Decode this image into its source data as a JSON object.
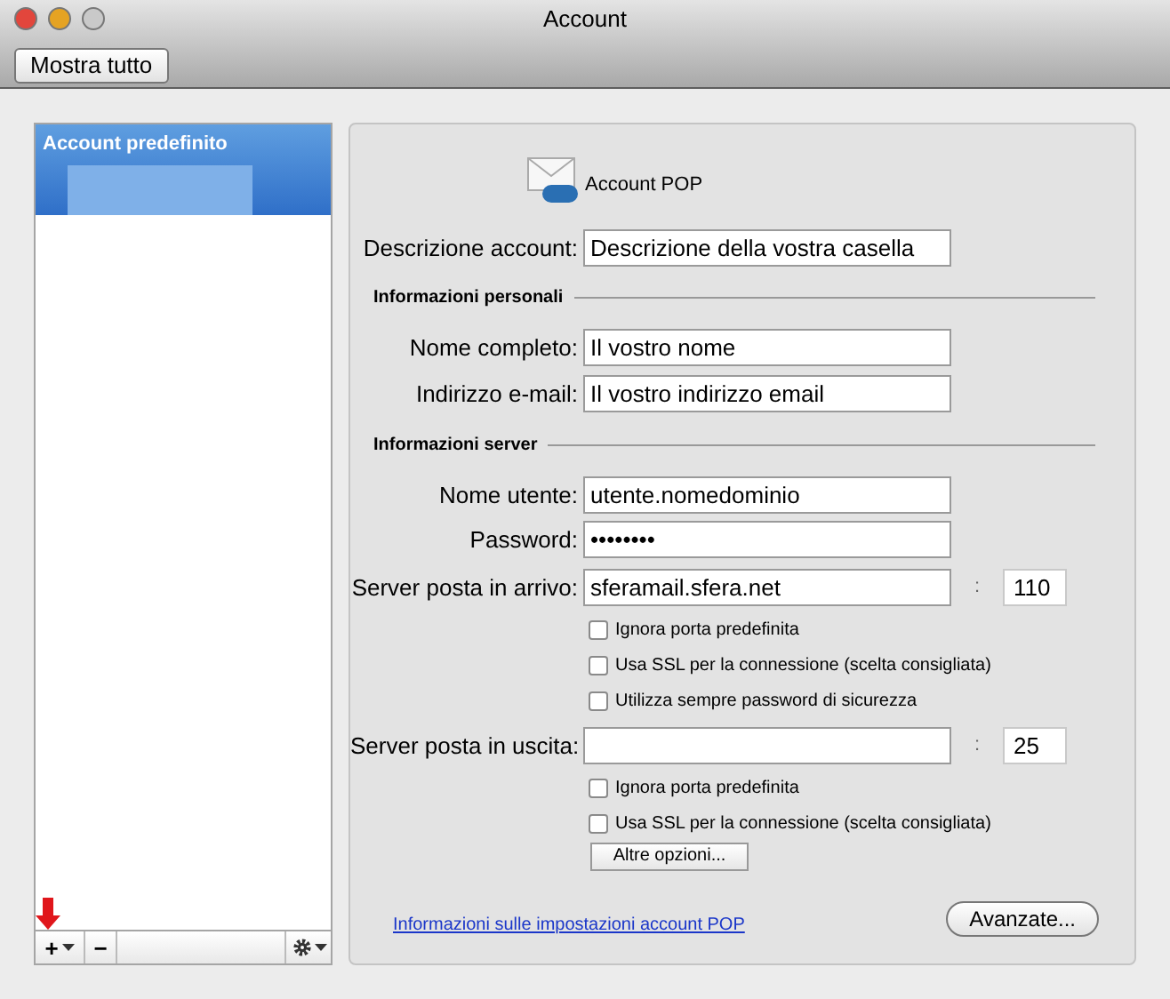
{
  "window": {
    "title": "Account"
  },
  "toolbar": {
    "show_all_button": "Mostra tutto"
  },
  "sidebar": {
    "items": [
      {
        "label": "Account predefinito",
        "selected": true,
        "redacted": true
      }
    ],
    "bottom_bar": {
      "add": "+",
      "remove": "−"
    }
  },
  "account": {
    "type_label": "Account POP",
    "description": {
      "label": "Descrizione account:",
      "value": "Descrizione della vostra casella"
    },
    "personal_heading": "Informazioni personali",
    "full_name": {
      "label": "Nome completo:",
      "value": "Il vostro nome"
    },
    "email": {
      "label": "Indirizzo e-mail:",
      "value": "Il vostro indirizzo email"
    },
    "server_heading": "Informazioni server",
    "username": {
      "label": "Nome utente:",
      "value": "utente.nomedominio"
    },
    "password": {
      "label": "Password:",
      "value": "••••••••"
    },
    "incoming": {
      "label": "Server posta in arrivo:",
      "value": "sferamail.sfera.net",
      "separator": ":",
      "port": "110",
      "options": [
        {
          "label": "Ignora porta predefinita",
          "checked": false
        },
        {
          "label": "Usa SSL per la connessione (scelta consigliata)",
          "checked": false
        },
        {
          "label": "Utilizza sempre password di sicurezza",
          "checked": false
        }
      ]
    },
    "outgoing": {
      "label": "Server posta in uscita:",
      "separator": ":",
      "port": "25",
      "options": [
        {
          "label": "Ignora porta predefinita",
          "checked": false
        },
        {
          "label": "Usa SSL per la connessione (scelta consigliata)",
          "checked": false
        }
      ],
      "more_button": "Altre opzioni..."
    },
    "help_link": "Informazioni sulle impostazioni account POP",
    "advanced_button": "Avanzate..."
  }
}
